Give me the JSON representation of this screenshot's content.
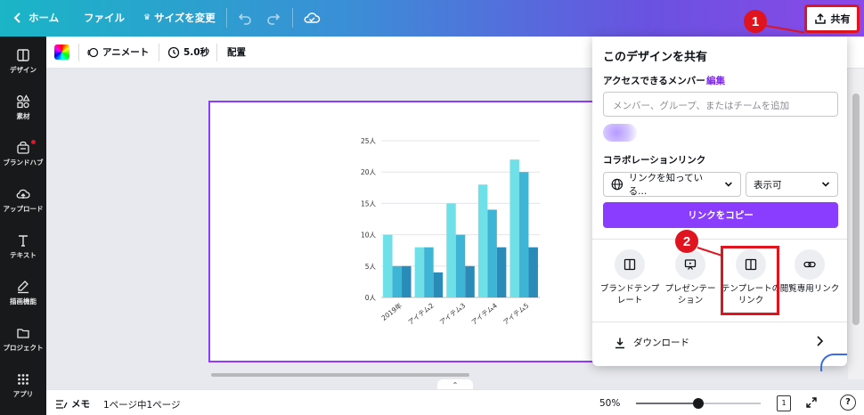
{
  "topbar": {
    "home_label": "ホーム",
    "file_label": "ファイル",
    "resize_label": "サイズを変更",
    "share_label": "共有"
  },
  "sidebar": {
    "items": [
      {
        "label": "デザイン",
        "icon": "layout-icon"
      },
      {
        "label": "素材",
        "icon": "shapes-icon"
      },
      {
        "label": "ブランドハブ",
        "icon": "brand-icon"
      },
      {
        "label": "アップロード",
        "icon": "cloud-upload-icon"
      },
      {
        "label": "テキスト",
        "icon": "text-icon"
      },
      {
        "label": "描画機能",
        "icon": "draw-icon"
      },
      {
        "label": "プロジェクト",
        "icon": "folder-icon"
      },
      {
        "label": "アプリ",
        "icon": "apps-icon"
      }
    ]
  },
  "edit_toolbar": {
    "animate_label": "アニメート",
    "duration_label": "5.0秒",
    "position_label": "配置"
  },
  "chart_data": {
    "type": "bar",
    "categories": [
      "2019年",
      "アイテム2",
      "アイテム3",
      "アイテム4",
      "アイテム5"
    ],
    "series": [
      {
        "values": [
          10,
          8,
          15,
          18,
          22
        ],
        "color": "#6fe0e8"
      },
      {
        "values": [
          5,
          8,
          10,
          14,
          20
        ],
        "color": "#3fb5d6"
      },
      {
        "values": [
          5,
          4,
          5,
          8,
          8
        ],
        "color": "#2a8ab8"
      }
    ],
    "ylim": [
      0,
      25
    ],
    "yticks": [
      0,
      5,
      10,
      15,
      20,
      25
    ],
    "ytick_labels": [
      "0人",
      "5人",
      "10人",
      "15人",
      "20人",
      "25人"
    ],
    "grid": true
  },
  "share_panel": {
    "title": "このデザインを共有",
    "access_label": "アクセスできるメンバー",
    "edit_link": "編集",
    "input_placeholder": "メンバー、グループ、またはチームを追加",
    "collab_label": "コラボレーションリンク",
    "link_scope": "リンクを知っている...",
    "link_permission": "表示可",
    "copy_button": "リンクをコピー",
    "options": [
      {
        "label": "ブランドテンプ\nレート",
        "icon": "brand-template-icon"
      },
      {
        "label": "プレゼンテー\nション",
        "icon": "presentation-icon"
      },
      {
        "label": "テンプレートの\nリンク",
        "icon": "template-link-icon"
      },
      {
        "label": "閲覧専用リンク",
        "icon": "link-icon"
      }
    ],
    "download_label": "ダウンロード"
  },
  "bottombar": {
    "memo_label": "メモ",
    "pages_label": "1ページ中1ページ",
    "zoom_label": "50%",
    "zoom_value": 0.5,
    "page_count": "1",
    "help_label": "?"
  },
  "annotations": {
    "marker1": "1",
    "marker2": "2",
    "color": "#e0141e"
  },
  "colors": {
    "accent": "#8b3dff",
    "sidebar_bg": "#18191b"
  }
}
